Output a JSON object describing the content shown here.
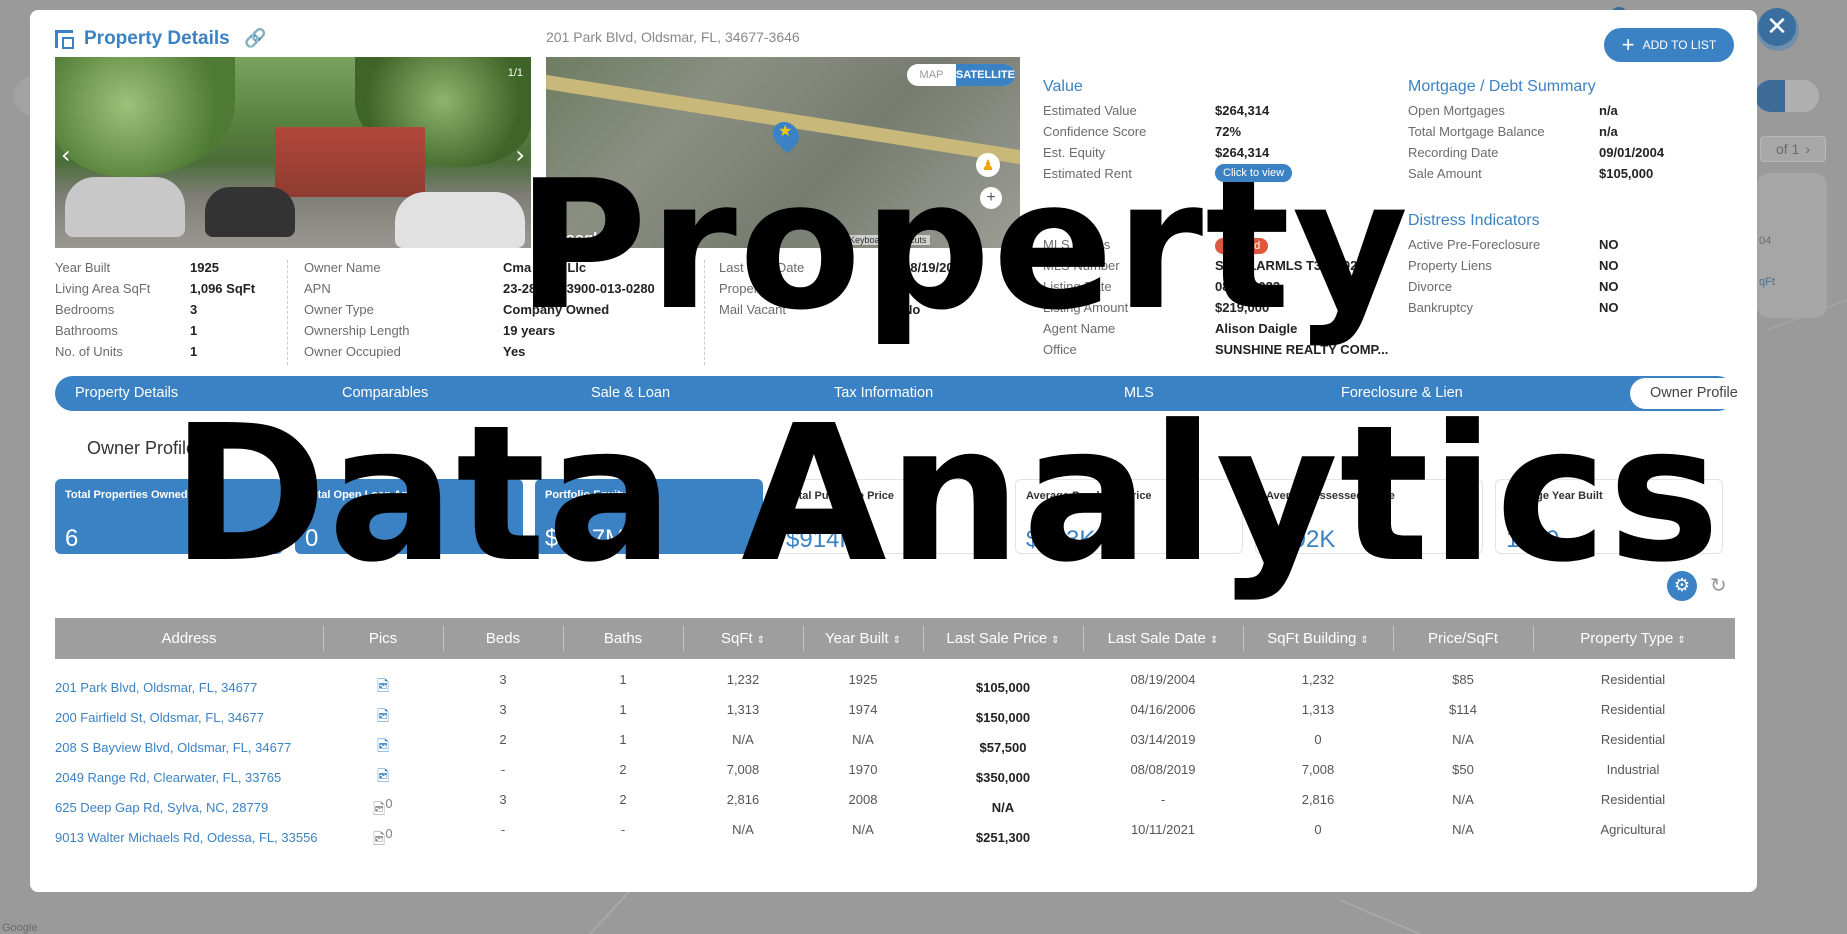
{
  "background": {
    "avatar_initials": "BM",
    "pager_text": "of 1",
    "pager_chevron": "›",
    "card_text_1": "04",
    "card_text_2": "qFt",
    "map_credit": "Google"
  },
  "modal": {
    "title": "Property Details",
    "address": "201 Park Blvd, Oldsmar, FL, 34677-3646",
    "add_button": "ADD TO LIST",
    "close_glyph": "✕",
    "photo_counter": "1/1",
    "map_toggle": {
      "map": "MAP",
      "satellite": "SATELLITE"
    },
    "map_google": "Google",
    "map_footer": "Keyboard shortcuts"
  },
  "facts_col1": [
    {
      "label": "Year Built",
      "value": "1925"
    },
    {
      "label": "Living Area SqFt",
      "value": "1,096 SqFt"
    },
    {
      "label": "Bedrooms",
      "value": "3"
    },
    {
      "label": "Bathrooms",
      "value": "1"
    },
    {
      "label": "No. of Units",
      "value": "1"
    }
  ],
  "facts_col2": [
    {
      "label": "Owner Name",
      "value": "Cma 2049 Llc"
    },
    {
      "label": "APN",
      "value": "23-28-16-63900-013-0280"
    },
    {
      "label": "Owner Type",
      "value": "Company Owned"
    },
    {
      "label": "Ownership Length",
      "value": "19 years"
    },
    {
      "label": "Owner Occupied",
      "value": "Yes"
    }
  ],
  "facts_col3": [
    {
      "label": "Last Sale Date",
      "value": "08/19/2004"
    },
    {
      "label": "Property",
      "value": ""
    },
    {
      "label": "Mail Vacant",
      "value": "No"
    }
  ],
  "value_section": {
    "title": "Value",
    "rows": [
      {
        "label": "Estimated Value",
        "value": "$264,314"
      },
      {
        "label": "Confidence Score",
        "value": "72%"
      },
      {
        "label": "Est. Equity",
        "value": "$264,314"
      },
      {
        "label": "Estimated Rent",
        "value": "Click to view"
      }
    ]
  },
  "mls_section": {
    "title": "MLS",
    "rows": [
      {
        "label": "MLS Status",
        "value": "Expired"
      },
      {
        "label": "MLS Number",
        "value": "STELLARMLS T3465025"
      },
      {
        "label": "Listing Date",
        "value": "08/07/2023"
      },
      {
        "label": "Listing Amount",
        "value": "$219,000"
      },
      {
        "label": "Agent Name",
        "value": "Alison Daigle"
      },
      {
        "label": "Office",
        "value": "SUNSHINE REALTY COMP..."
      }
    ]
  },
  "mortgage_section": {
    "title": "Mortgage / Debt Summary",
    "rows": [
      {
        "label": "Open Mortgages",
        "value": "n/a"
      },
      {
        "label": "Total Mortgage Balance",
        "value": "n/a"
      },
      {
        "label": "Recording Date",
        "value": "09/01/2004"
      },
      {
        "label": "Sale Amount",
        "value": "$105,000"
      }
    ]
  },
  "distress_section": {
    "title": "Distress Indicators",
    "rows": [
      {
        "label": "Active Pre-Foreclosure",
        "value": "NO"
      },
      {
        "label": "Property Liens",
        "value": "NO"
      },
      {
        "label": "Divorce",
        "value": "NO"
      },
      {
        "label": "Bankruptcy",
        "value": "NO"
      }
    ]
  },
  "tabs": [
    "Property Details",
    "Comparables",
    "Sale & Loan",
    "Tax Information",
    "MLS",
    "Foreclosure & Lien",
    "Owner Profile"
  ],
  "owner_profile": {
    "title": "Owner Profile",
    "stats": [
      {
        "label": "Total Properties Owned",
        "value": "6"
      },
      {
        "label": "Total Open Loan Amount",
        "value": "0"
      },
      {
        "label": "Portfolio Equity",
        "value": "$1.17M"
      },
      {
        "label": "Total Purchase Price",
        "value": "$914K"
      },
      {
        "label": "Average Purchase Price",
        "value": "$183K"
      },
      {
        "label": "Average Assessed Value",
        "value": "$192K"
      },
      {
        "label": "Average Year Built",
        "value": "1969"
      }
    ]
  },
  "table": {
    "headers": [
      "Address",
      "Pics",
      "Beds",
      "Baths",
      "SqFt",
      "Year Built",
      "Last Sale Price",
      "Last Sale Date",
      "SqFt Building",
      "Price/SqFt",
      "Property Type"
    ],
    "rows": [
      [
        "201 Park Blvd, Oldsmar, FL, 34677",
        "",
        "3",
        "1",
        "1,232",
        "1925",
        "$105,000",
        "08/19/2004",
        "1,232",
        "$85",
        "Residential"
      ],
      [
        "200 Fairfield St, Oldsmar, FL, 34677",
        "",
        "3",
        "1",
        "1,313",
        "1974",
        "$150,000",
        "04/16/2006",
        "1,313",
        "$114",
        "Residential"
      ],
      [
        "208 S Bayview Blvd, Oldsmar, FL, 34677",
        "",
        "2",
        "1",
        "N/A",
        "N/A",
        "$57,500",
        "03/14/2019",
        "0",
        "N/A",
        "Residential"
      ],
      [
        "2049 Range Rd, Clearwater, FL, 33765",
        "",
        "-",
        "2",
        "7,008",
        "1970",
        "$350,000",
        "08/08/2019",
        "7,008",
        "$50",
        "Industrial"
      ],
      [
        "625 Deep Gap Rd, Sylva, NC, 28779",
        "",
        "3",
        "2",
        "2,816",
        "2008",
        "N/A",
        "-",
        "2,816",
        "N/A",
        "Residential"
      ],
      [
        "9013 Walter Michaels Rd, Odessa, FL, 33556",
        "",
        "-",
        "-",
        "N/A",
        "N/A",
        "$251,300",
        "10/11/2021",
        "0",
        "N/A",
        "Agricultural"
      ]
    ],
    "pic_badges": [
      "",
      "",
      "",
      "",
      "0",
      "0"
    ]
  },
  "watermark": {
    "line1": "Property",
    "line2": "Data Analytics"
  }
}
